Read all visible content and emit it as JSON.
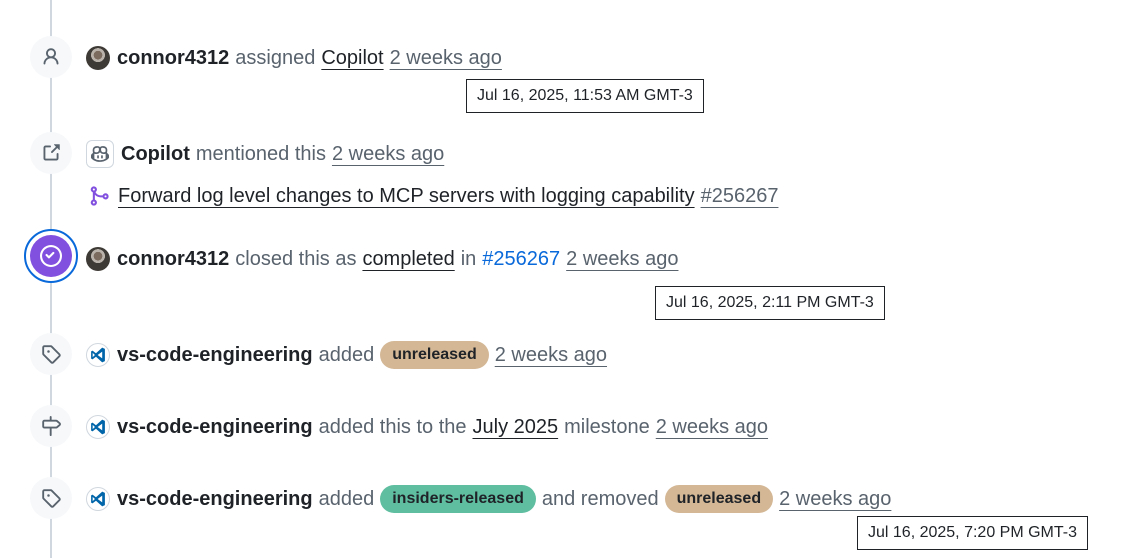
{
  "events": [
    {
      "icon": "person-icon",
      "actor": "connor4312",
      "verb": "assigned",
      "target": "Copilot",
      "time": "2 weeks ago",
      "tooltip": "Jul 16, 2025, 11:53 AM GMT-3"
    },
    {
      "icon": "external-link-icon",
      "actor": "Copilot",
      "verb": "mentioned this",
      "time": "2 weeks ago",
      "pr_icon": "git-pull-request-icon",
      "pr_title": "Forward log level changes to MCP servers with logging capability",
      "pr_number": "#256267"
    },
    {
      "icon": "check-circle-icon",
      "actor": "connor4312",
      "verb": "closed this as",
      "state": "completed",
      "connector": "in",
      "ref": "#256267",
      "time": "2 weeks ago",
      "tooltip": "Jul 16, 2025, 2:11 PM GMT-3"
    },
    {
      "icon": "tag-icon",
      "actor": "vs-code-engineering",
      "verb": "added",
      "label": {
        "name": "unreleased",
        "color": "#d4b896"
      },
      "time": "2 weeks ago"
    },
    {
      "icon": "milestone-icon",
      "actor": "vs-code-engineering",
      "verb": "added this to the",
      "milestone": "July 2025",
      "suffix": "milestone",
      "time": "2 weeks ago"
    },
    {
      "icon": "tag-icon",
      "actor": "vs-code-engineering",
      "verb": "added",
      "label": {
        "name": "insiders-released",
        "color": "#5fbea0"
      },
      "connector": "and removed",
      "removed_label": {
        "name": "unreleased",
        "color": "#d4b896"
      },
      "time": "2 weeks ago",
      "tooltip": "Jul 16, 2025, 7:20 PM GMT-3"
    }
  ],
  "colors": {
    "closed_purple": "#8250df",
    "focus_blue": "#0969da",
    "link_blue": "#0969da",
    "muted": "#59636e"
  }
}
